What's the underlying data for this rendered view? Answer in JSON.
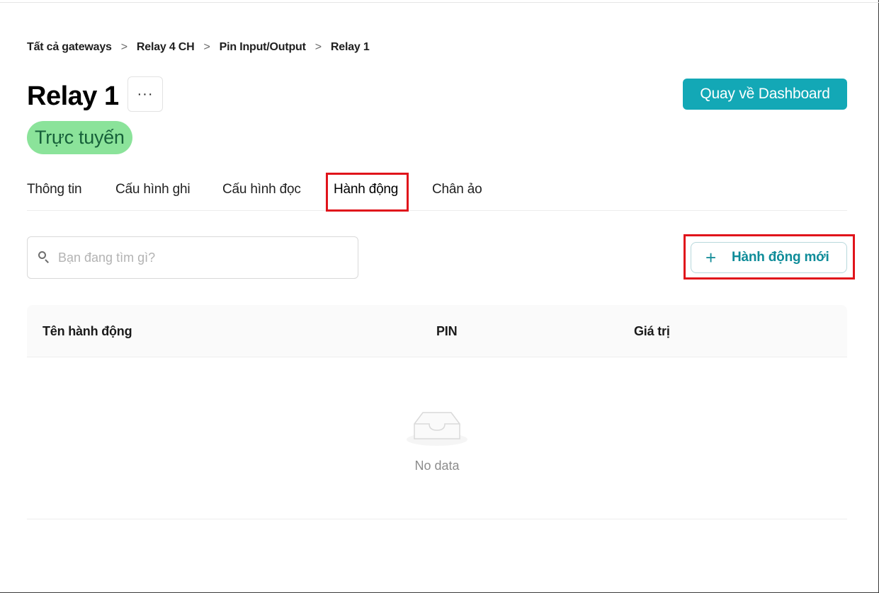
{
  "breadcrumb": {
    "items": [
      "Tất cả gateways",
      "Relay 4 CH",
      "Pin Input/Output",
      "Relay 1"
    ],
    "separator": ">"
  },
  "header": {
    "title": "Relay 1",
    "more_label": "···",
    "status": "Trực tuyến",
    "back_button": "Quay về Dashboard"
  },
  "tabs": [
    {
      "label": "Thông tin",
      "active": false
    },
    {
      "label": "Cấu hình ghi",
      "active": false
    },
    {
      "label": "Cấu hình đọc",
      "active": false
    },
    {
      "label": "Hành động",
      "active": true
    },
    {
      "label": "Chân ảo",
      "active": false
    }
  ],
  "search": {
    "placeholder": "Bạn đang tìm gì?",
    "value": ""
  },
  "actions": {
    "new_button": "Hành động mới",
    "plus": "+"
  },
  "table": {
    "columns": [
      "Tên hành động",
      "PIN",
      "Giá trị"
    ],
    "rows": [],
    "empty_text": "No data"
  },
  "colors": {
    "accent": "#13a8b6",
    "status_bg": "#8be39a",
    "status_text": "#17613a",
    "highlight": "#e0141b"
  },
  "icons": {
    "search": "search-icon",
    "more": "ellipsis-icon",
    "plus": "plus-icon",
    "empty": "empty-inbox-icon"
  }
}
